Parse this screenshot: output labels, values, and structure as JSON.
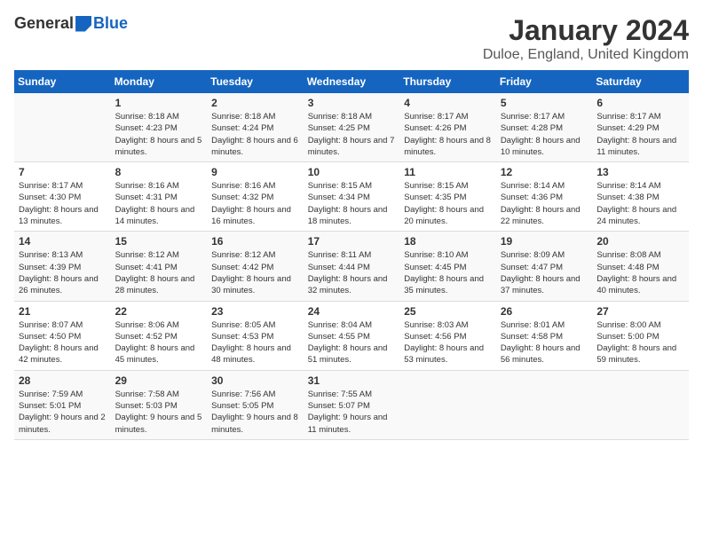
{
  "header": {
    "logo_general": "General",
    "logo_blue": "Blue",
    "month_title": "January 2024",
    "location": "Duloe, England, United Kingdom"
  },
  "columns": [
    "Sunday",
    "Monday",
    "Tuesday",
    "Wednesday",
    "Thursday",
    "Friday",
    "Saturday"
  ],
  "weeks": [
    [
      {
        "day": "",
        "sunrise": "",
        "sunset": "",
        "daylight": ""
      },
      {
        "day": "1",
        "sunrise": "Sunrise: 8:18 AM",
        "sunset": "Sunset: 4:23 PM",
        "daylight": "Daylight: 8 hours and 5 minutes."
      },
      {
        "day": "2",
        "sunrise": "Sunrise: 8:18 AM",
        "sunset": "Sunset: 4:24 PM",
        "daylight": "Daylight: 8 hours and 6 minutes."
      },
      {
        "day": "3",
        "sunrise": "Sunrise: 8:18 AM",
        "sunset": "Sunset: 4:25 PM",
        "daylight": "Daylight: 8 hours and 7 minutes."
      },
      {
        "day": "4",
        "sunrise": "Sunrise: 8:17 AM",
        "sunset": "Sunset: 4:26 PM",
        "daylight": "Daylight: 8 hours and 8 minutes."
      },
      {
        "day": "5",
        "sunrise": "Sunrise: 8:17 AM",
        "sunset": "Sunset: 4:28 PM",
        "daylight": "Daylight: 8 hours and 10 minutes."
      },
      {
        "day": "6",
        "sunrise": "Sunrise: 8:17 AM",
        "sunset": "Sunset: 4:29 PM",
        "daylight": "Daylight: 8 hours and 11 minutes."
      }
    ],
    [
      {
        "day": "7",
        "sunrise": "Sunrise: 8:17 AM",
        "sunset": "Sunset: 4:30 PM",
        "daylight": "Daylight: 8 hours and 13 minutes."
      },
      {
        "day": "8",
        "sunrise": "Sunrise: 8:16 AM",
        "sunset": "Sunset: 4:31 PM",
        "daylight": "Daylight: 8 hours and 14 minutes."
      },
      {
        "day": "9",
        "sunrise": "Sunrise: 8:16 AM",
        "sunset": "Sunset: 4:32 PM",
        "daylight": "Daylight: 8 hours and 16 minutes."
      },
      {
        "day": "10",
        "sunrise": "Sunrise: 8:15 AM",
        "sunset": "Sunset: 4:34 PM",
        "daylight": "Daylight: 8 hours and 18 minutes."
      },
      {
        "day": "11",
        "sunrise": "Sunrise: 8:15 AM",
        "sunset": "Sunset: 4:35 PM",
        "daylight": "Daylight: 8 hours and 20 minutes."
      },
      {
        "day": "12",
        "sunrise": "Sunrise: 8:14 AM",
        "sunset": "Sunset: 4:36 PM",
        "daylight": "Daylight: 8 hours and 22 minutes."
      },
      {
        "day": "13",
        "sunrise": "Sunrise: 8:14 AM",
        "sunset": "Sunset: 4:38 PM",
        "daylight": "Daylight: 8 hours and 24 minutes."
      }
    ],
    [
      {
        "day": "14",
        "sunrise": "Sunrise: 8:13 AM",
        "sunset": "Sunset: 4:39 PM",
        "daylight": "Daylight: 8 hours and 26 minutes."
      },
      {
        "day": "15",
        "sunrise": "Sunrise: 8:12 AM",
        "sunset": "Sunset: 4:41 PM",
        "daylight": "Daylight: 8 hours and 28 minutes."
      },
      {
        "day": "16",
        "sunrise": "Sunrise: 8:12 AM",
        "sunset": "Sunset: 4:42 PM",
        "daylight": "Daylight: 8 hours and 30 minutes."
      },
      {
        "day": "17",
        "sunrise": "Sunrise: 8:11 AM",
        "sunset": "Sunset: 4:44 PM",
        "daylight": "Daylight: 8 hours and 32 minutes."
      },
      {
        "day": "18",
        "sunrise": "Sunrise: 8:10 AM",
        "sunset": "Sunset: 4:45 PM",
        "daylight": "Daylight: 8 hours and 35 minutes."
      },
      {
        "day": "19",
        "sunrise": "Sunrise: 8:09 AM",
        "sunset": "Sunset: 4:47 PM",
        "daylight": "Daylight: 8 hours and 37 minutes."
      },
      {
        "day": "20",
        "sunrise": "Sunrise: 8:08 AM",
        "sunset": "Sunset: 4:48 PM",
        "daylight": "Daylight: 8 hours and 40 minutes."
      }
    ],
    [
      {
        "day": "21",
        "sunrise": "Sunrise: 8:07 AM",
        "sunset": "Sunset: 4:50 PM",
        "daylight": "Daylight: 8 hours and 42 minutes."
      },
      {
        "day": "22",
        "sunrise": "Sunrise: 8:06 AM",
        "sunset": "Sunset: 4:52 PM",
        "daylight": "Daylight: 8 hours and 45 minutes."
      },
      {
        "day": "23",
        "sunrise": "Sunrise: 8:05 AM",
        "sunset": "Sunset: 4:53 PM",
        "daylight": "Daylight: 8 hours and 48 minutes."
      },
      {
        "day": "24",
        "sunrise": "Sunrise: 8:04 AM",
        "sunset": "Sunset: 4:55 PM",
        "daylight": "Daylight: 8 hours and 51 minutes."
      },
      {
        "day": "25",
        "sunrise": "Sunrise: 8:03 AM",
        "sunset": "Sunset: 4:56 PM",
        "daylight": "Daylight: 8 hours and 53 minutes."
      },
      {
        "day": "26",
        "sunrise": "Sunrise: 8:01 AM",
        "sunset": "Sunset: 4:58 PM",
        "daylight": "Daylight: 8 hours and 56 minutes."
      },
      {
        "day": "27",
        "sunrise": "Sunrise: 8:00 AM",
        "sunset": "Sunset: 5:00 PM",
        "daylight": "Daylight: 8 hours and 59 minutes."
      }
    ],
    [
      {
        "day": "28",
        "sunrise": "Sunrise: 7:59 AM",
        "sunset": "Sunset: 5:01 PM",
        "daylight": "Daylight: 9 hours and 2 minutes."
      },
      {
        "day": "29",
        "sunrise": "Sunrise: 7:58 AM",
        "sunset": "Sunset: 5:03 PM",
        "daylight": "Daylight: 9 hours and 5 minutes."
      },
      {
        "day": "30",
        "sunrise": "Sunrise: 7:56 AM",
        "sunset": "Sunset: 5:05 PM",
        "daylight": "Daylight: 9 hours and 8 minutes."
      },
      {
        "day": "31",
        "sunrise": "Sunrise: 7:55 AM",
        "sunset": "Sunset: 5:07 PM",
        "daylight": "Daylight: 9 hours and 11 minutes."
      },
      {
        "day": "",
        "sunrise": "",
        "sunset": "",
        "daylight": ""
      },
      {
        "day": "",
        "sunrise": "",
        "sunset": "",
        "daylight": ""
      },
      {
        "day": "",
        "sunrise": "",
        "sunset": "",
        "daylight": ""
      }
    ]
  ]
}
